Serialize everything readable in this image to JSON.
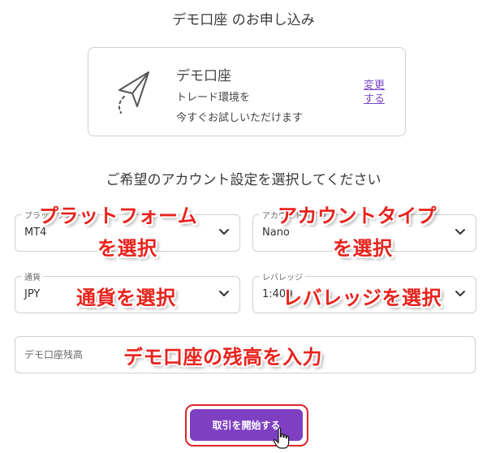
{
  "page_title": "デモ口座 のお申し込み",
  "demo_card": {
    "title": "デモ口座",
    "description_line1": "トレード環境を",
    "description_line2": "今すぐお試しいただけます",
    "change_link": "変更する",
    "icon": "paper-plane-icon"
  },
  "section_heading": "ご希望のアカウント設定を選択してください",
  "fields": {
    "platform": {
      "label": "プラットフォーム",
      "value": "MT4",
      "icon": "chevron-down-icon"
    },
    "account_type": {
      "label": "アカウントタイプ",
      "value": "Nano",
      "icon": "chevron-down-icon"
    },
    "currency": {
      "label": "通貨",
      "value": "JPY",
      "icon": "chevron-down-icon"
    },
    "leverage": {
      "label": "レバレッジ",
      "value": "1:400",
      "icon": "chevron-down-icon"
    },
    "balance": {
      "placeholder": "デモ口座残高"
    }
  },
  "start_button": {
    "label": "取引を開始する"
  },
  "annotations": {
    "platform_line1": "プラットフォーム",
    "platform_line2": "を選択",
    "account_type_line1": "アカウントタイプ",
    "account_type_line2": "を選択",
    "currency": "通貨を選択",
    "leverage": "レバレッジを選択",
    "balance": "デモ口座の残高を入力"
  },
  "colors": {
    "accent_purple": "#7e3fc3",
    "annotation_red": "#e8231d",
    "highlight_border": "#e0242d"
  }
}
